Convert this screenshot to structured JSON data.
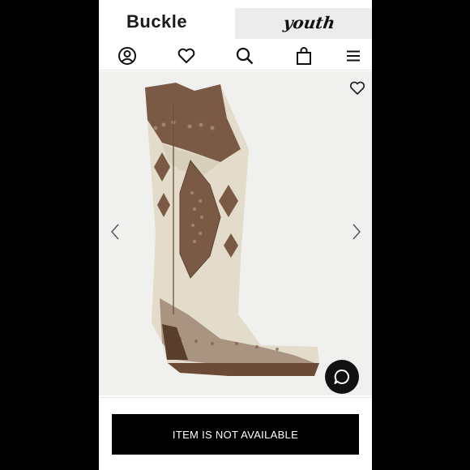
{
  "header": {
    "brand_name": "Buckle",
    "section_tab": "youth"
  },
  "nav_icons": [
    "account-icon",
    "heart-icon",
    "search-icon",
    "bag-icon",
    "menu-icon"
  ],
  "product": {
    "image": "brown-and-cream-studded-cowboy-boot",
    "favorite_icon": "heart-outline-icon",
    "prev_icon": "chevron-left-icon",
    "next_icon": "chevron-right-icon"
  },
  "chat": {
    "icon": "chat-bubble-icon"
  },
  "footer": {
    "status_label": "ITEM IS NOT AVAILABLE"
  },
  "colors": {
    "page_background": "#000000",
    "panel_background": "#ffffff",
    "tab_background": "#ececec",
    "product_background": "#f0f0ef",
    "button_background": "#000000",
    "boot_brown": "#7a5a45",
    "boot_cream": "#e3dccb"
  }
}
